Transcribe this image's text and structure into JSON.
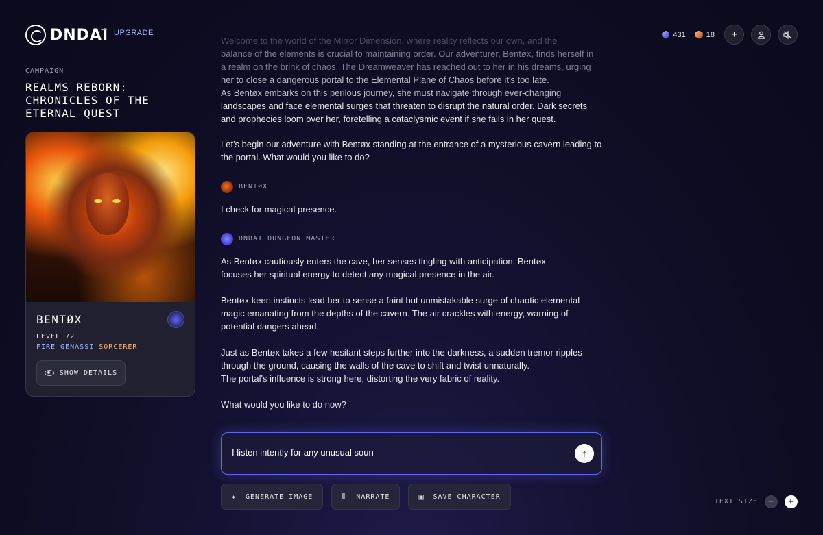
{
  "header": {
    "logo_text": "DNDAI",
    "upgrade_label": "UPGRADE",
    "crystals": "431",
    "cubes": "18",
    "icons": [
      "plus-icon",
      "user-icon",
      "mute-icon"
    ]
  },
  "campaign": {
    "label": "CAMPAIGN",
    "title": "REALMS REBORN: CHRONICLES OF THE ETERNAL QUEST"
  },
  "character": {
    "name": "BENTØX",
    "level": "LEVEL 72",
    "race": "FIRE GENASSI",
    "class": "SORCERER",
    "details_label": "SHOW DETAILS"
  },
  "chat": {
    "intro": [
      "Welcome to the world of the Mirror Dimension, where reality reflects our own, and the",
      "balance of the elements is crucial to maintaining order. Our adventurer, Bentøx, finds herself in",
      "a realm on the brink of chaos. The Dreamweaver has reached out to her in his dreams, urging",
      "her to close a dangerous portal to the Elemental Plane of Chaos before it's too late.",
      "As Bentøx embarks on this perilous journey, she must navigate through ever-changing",
      "landscapes and face elemental surges that threaten to disrupt the natural order. Dark secrets",
      "and prophecies loom over her, foretelling a cataclysmic event if she fails in her quest."
    ],
    "intro2": "Let's begin our adventure with Bentøx standing at the entrance of a mysterious cavern leading to the portal. What would you like to do?",
    "user_speaker": "BENTØX",
    "user_message": "I check for magical presence.",
    "dm_speaker": "DNDAI DUNGEON MASTER",
    "dm_p1": "As Bentøx cautiously enters the cave, her senses tingling with anticipation, Bentøx focuses her spiritual energy to detect any magical presence in the air.",
    "dm_p2": "Bentøx keen instincts lead her to sense a faint but unmistakable surge of chaotic elemental magic emanating from the depths of the cavern. The air crackles with energy, warning of potential dangers ahead.",
    "dm_p3a": "Just as Bentøx takes a few hesitant steps further into the darkness, a sudden tremor ripples through the ground, causing the walls of the cave to shift and twist unnaturally.",
    "dm_p3b": "The portal's influence is strong here, distorting the very fabric of reality.",
    "dm_p4": "What would you like to do now?"
  },
  "input": {
    "value": "I listen intently for any unusual soun"
  },
  "actions": {
    "generate": "GENERATE IMAGE",
    "narrate": "NARRATE",
    "save": "SAVE CHARACTER"
  },
  "text_size": {
    "label": "TEXT SIZE",
    "minus": "−",
    "plus": "+"
  },
  "colors": {
    "accent": "#6366f1",
    "race": "#a5b4fc",
    "class": "#fdba74"
  }
}
